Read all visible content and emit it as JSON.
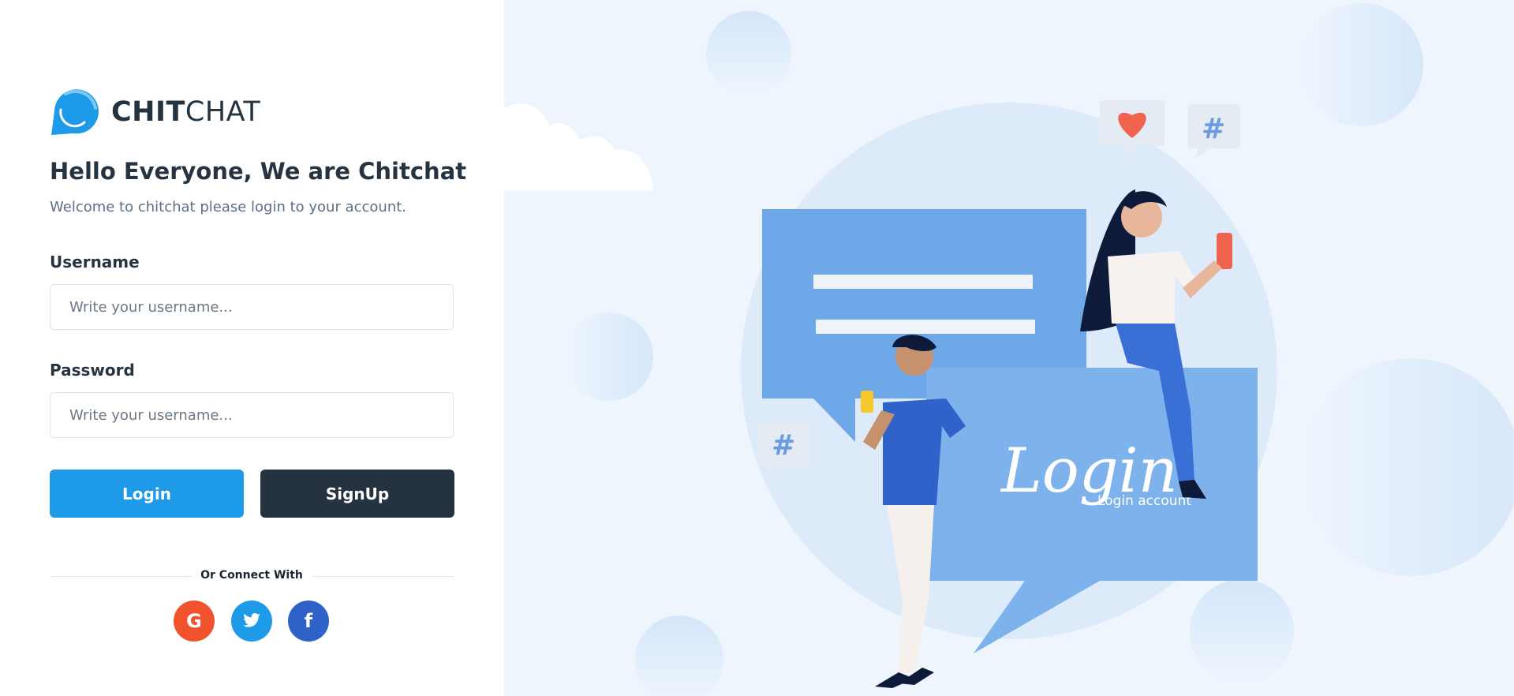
{
  "brand": {
    "bold": "CHIT",
    "light": "CHAT"
  },
  "heading": "Hello Everyone, We are Chitchat",
  "subheading": "Welcome to chitchat please login to your account.",
  "form": {
    "username_label": "Username",
    "username_placeholder": "Write your username...",
    "password_label": "Password",
    "password_placeholder": "Write your username..."
  },
  "buttons": {
    "login": "Login",
    "signup": "SignUp"
  },
  "connect_label": "Or Connect With",
  "social": [
    {
      "name": "google",
      "glyph": "G",
      "color": "#f0532d"
    },
    {
      "name": "twitter",
      "glyph": "twitter-icon",
      "color": "#1e9be8"
    },
    {
      "name": "facebook",
      "glyph": "f",
      "color": "#2f62c7"
    }
  ],
  "illustration": {
    "script_text": "Login",
    "caption": "Login account"
  },
  "colors": {
    "primary": "#1e9be8",
    "dark": "#253341",
    "panel_bg": "#eef5fd"
  }
}
